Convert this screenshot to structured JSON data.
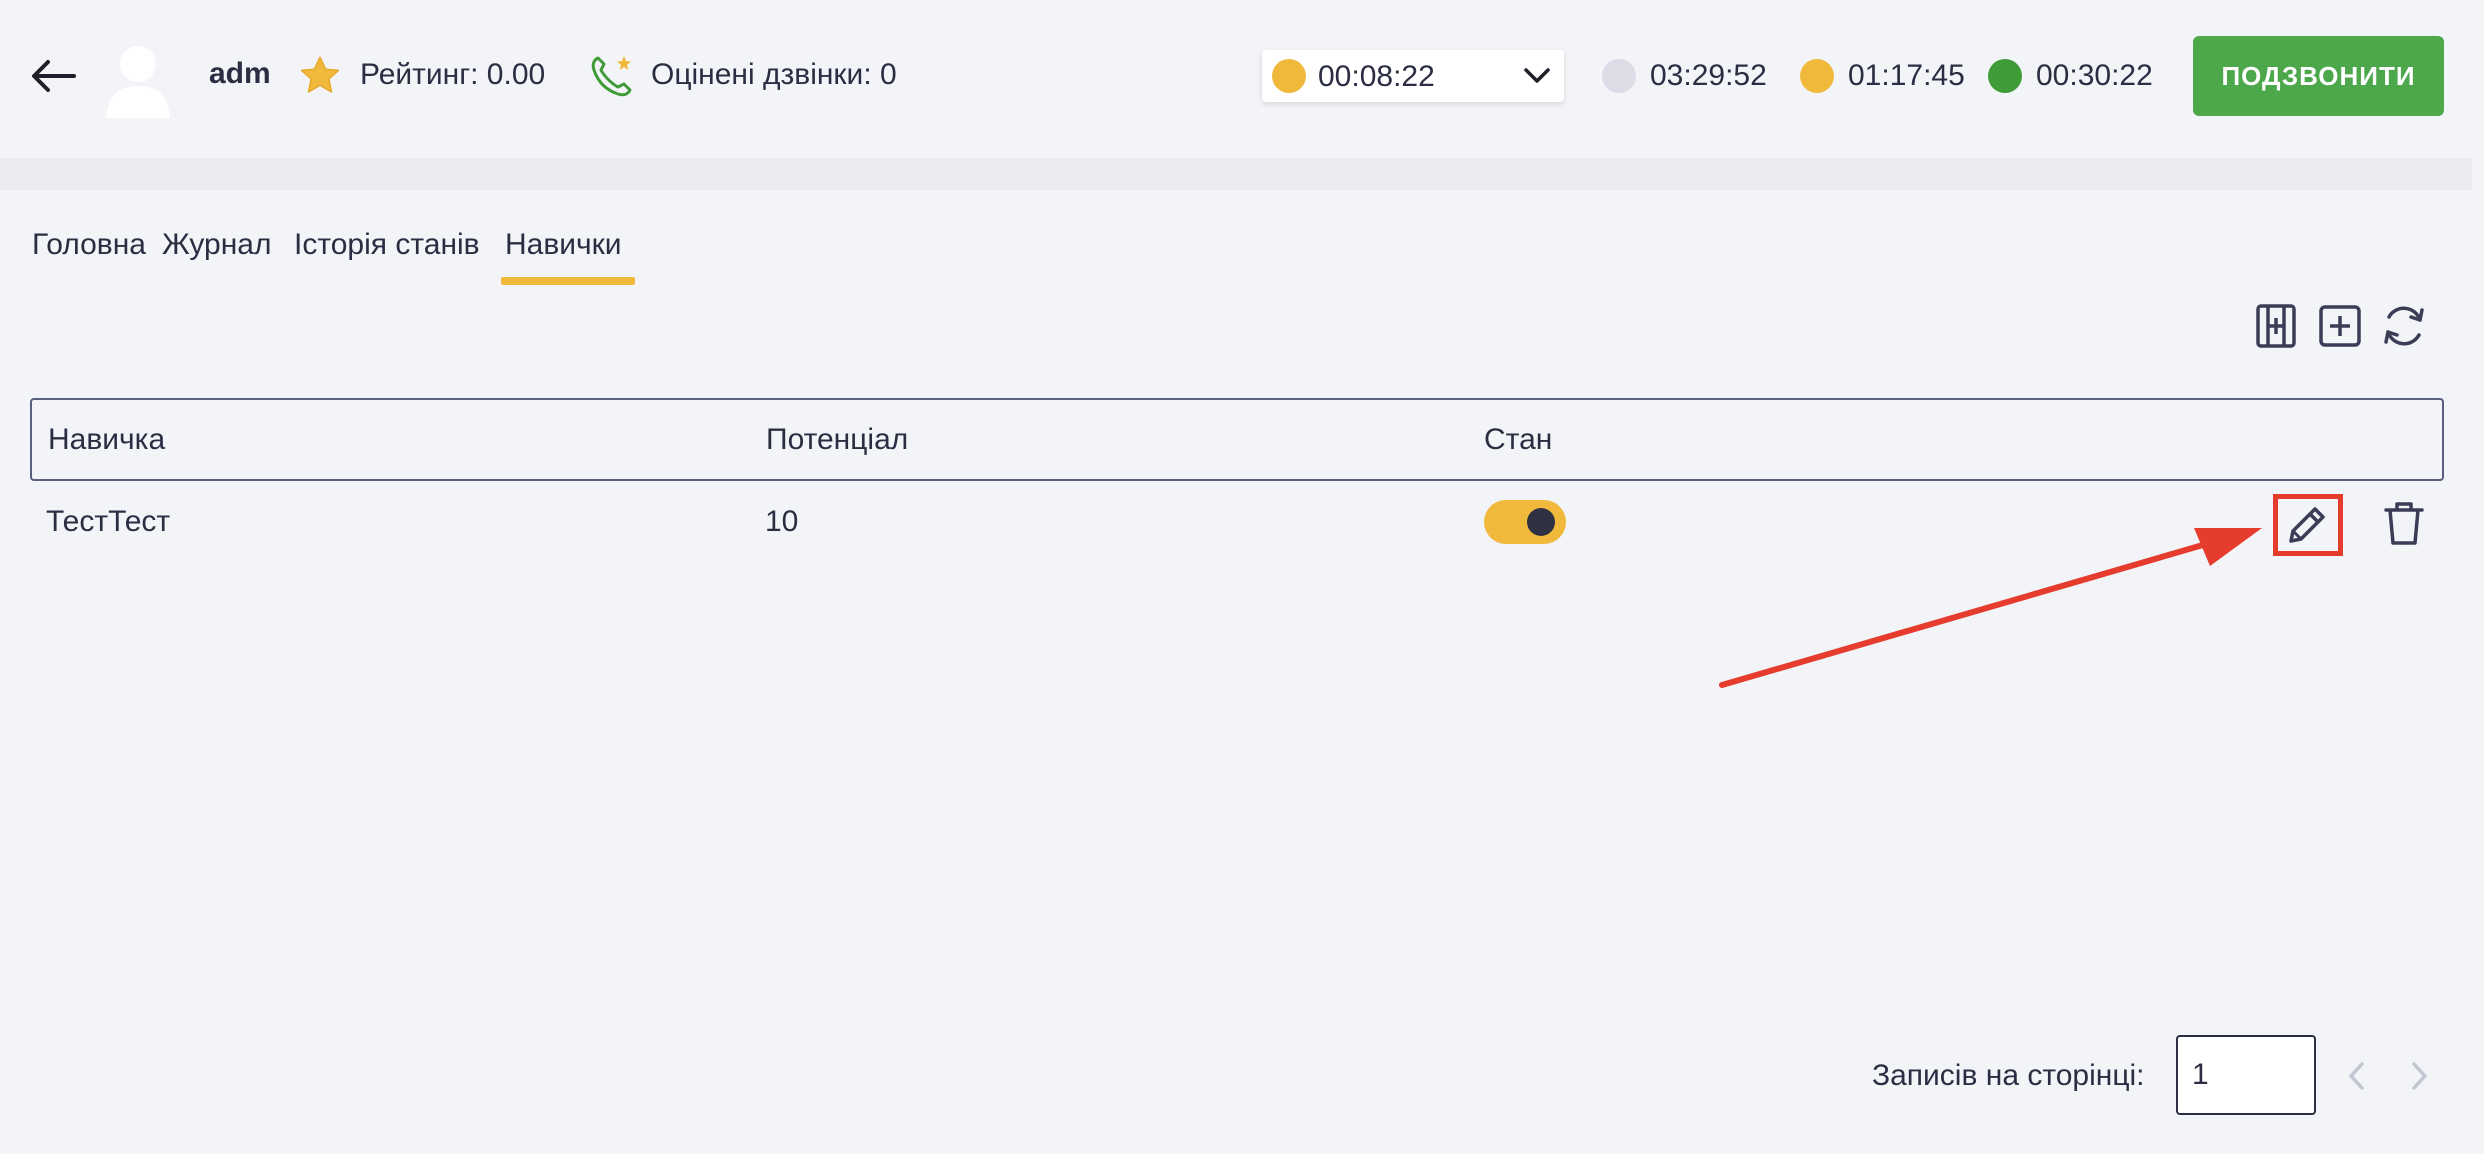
{
  "header": {
    "username": "adm",
    "rating": "Рейтинг: 0.00",
    "rated_calls": "Оцінені дзвінки: 0",
    "status_select": {
      "time": "00:08:22",
      "color": "#f0b93b"
    },
    "timers": [
      {
        "time": "03:29:52",
        "color": "#dcdce6"
      },
      {
        "time": "01:17:45",
        "color": "#f0b93b"
      },
      {
        "time": "00:30:22",
        "color": "#3e9b36"
      }
    ],
    "call_button": "ПОДЗВОНИТИ"
  },
  "tabs": [
    {
      "label": "Головна",
      "active": false
    },
    {
      "label": "Журнал",
      "active": false
    },
    {
      "label": "Історія станів",
      "active": false
    },
    {
      "label": "Навички",
      "active": true
    }
  ],
  "toolbar": {
    "icons": [
      "columns-settings-icon",
      "add-icon",
      "refresh-icon"
    ]
  },
  "table": {
    "columns": [
      "Навичка",
      "Потенціал",
      "Стан"
    ],
    "rows": [
      {
        "skill": "ТестТест",
        "potential": "10",
        "state_on": true
      }
    ]
  },
  "pagination": {
    "per_page_label": "Записів на сторінці:",
    "per_page_value": "1"
  },
  "colors": {
    "accent": "#f0b93b",
    "call_button": "#4ca84b",
    "annotation": "#e63c2e"
  }
}
